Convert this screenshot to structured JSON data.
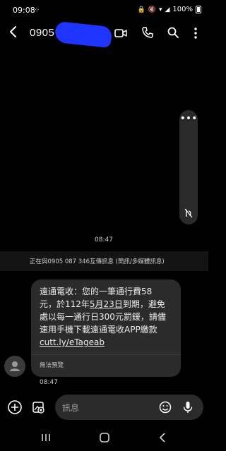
{
  "status_bar": {
    "time": "09:08",
    "battery": "100%"
  },
  "header": {
    "contact_number": "0905"
  },
  "side_panel": {
    "icons": [
      "more-dots-icon",
      "link-off-icon"
    ]
  },
  "conversation": {
    "time_top": "08:47",
    "banner": "正在與0905 087 346互傳訊息 (簡訊/多媒體訊息)",
    "message": {
      "line1": "遠通電收：您的一筆通行費58",
      "line2_a": "元，於112年",
      "line2_date": "5月23日",
      "line2_b": "到期，避免",
      "line3": "處以每一通行日300元罰鍰，請儘",
      "line4": "速用手機下載遠通電收APP繳款",
      "link": "cutt.ly/eTageab",
      "no_preview": "無法預覽"
    },
    "time_bottom": "08:47"
  },
  "composer": {
    "placeholder": "訊息"
  },
  "colors": {
    "background": "#000000",
    "bubble": "#2b2b2b",
    "redaction": "#1d35ff"
  }
}
